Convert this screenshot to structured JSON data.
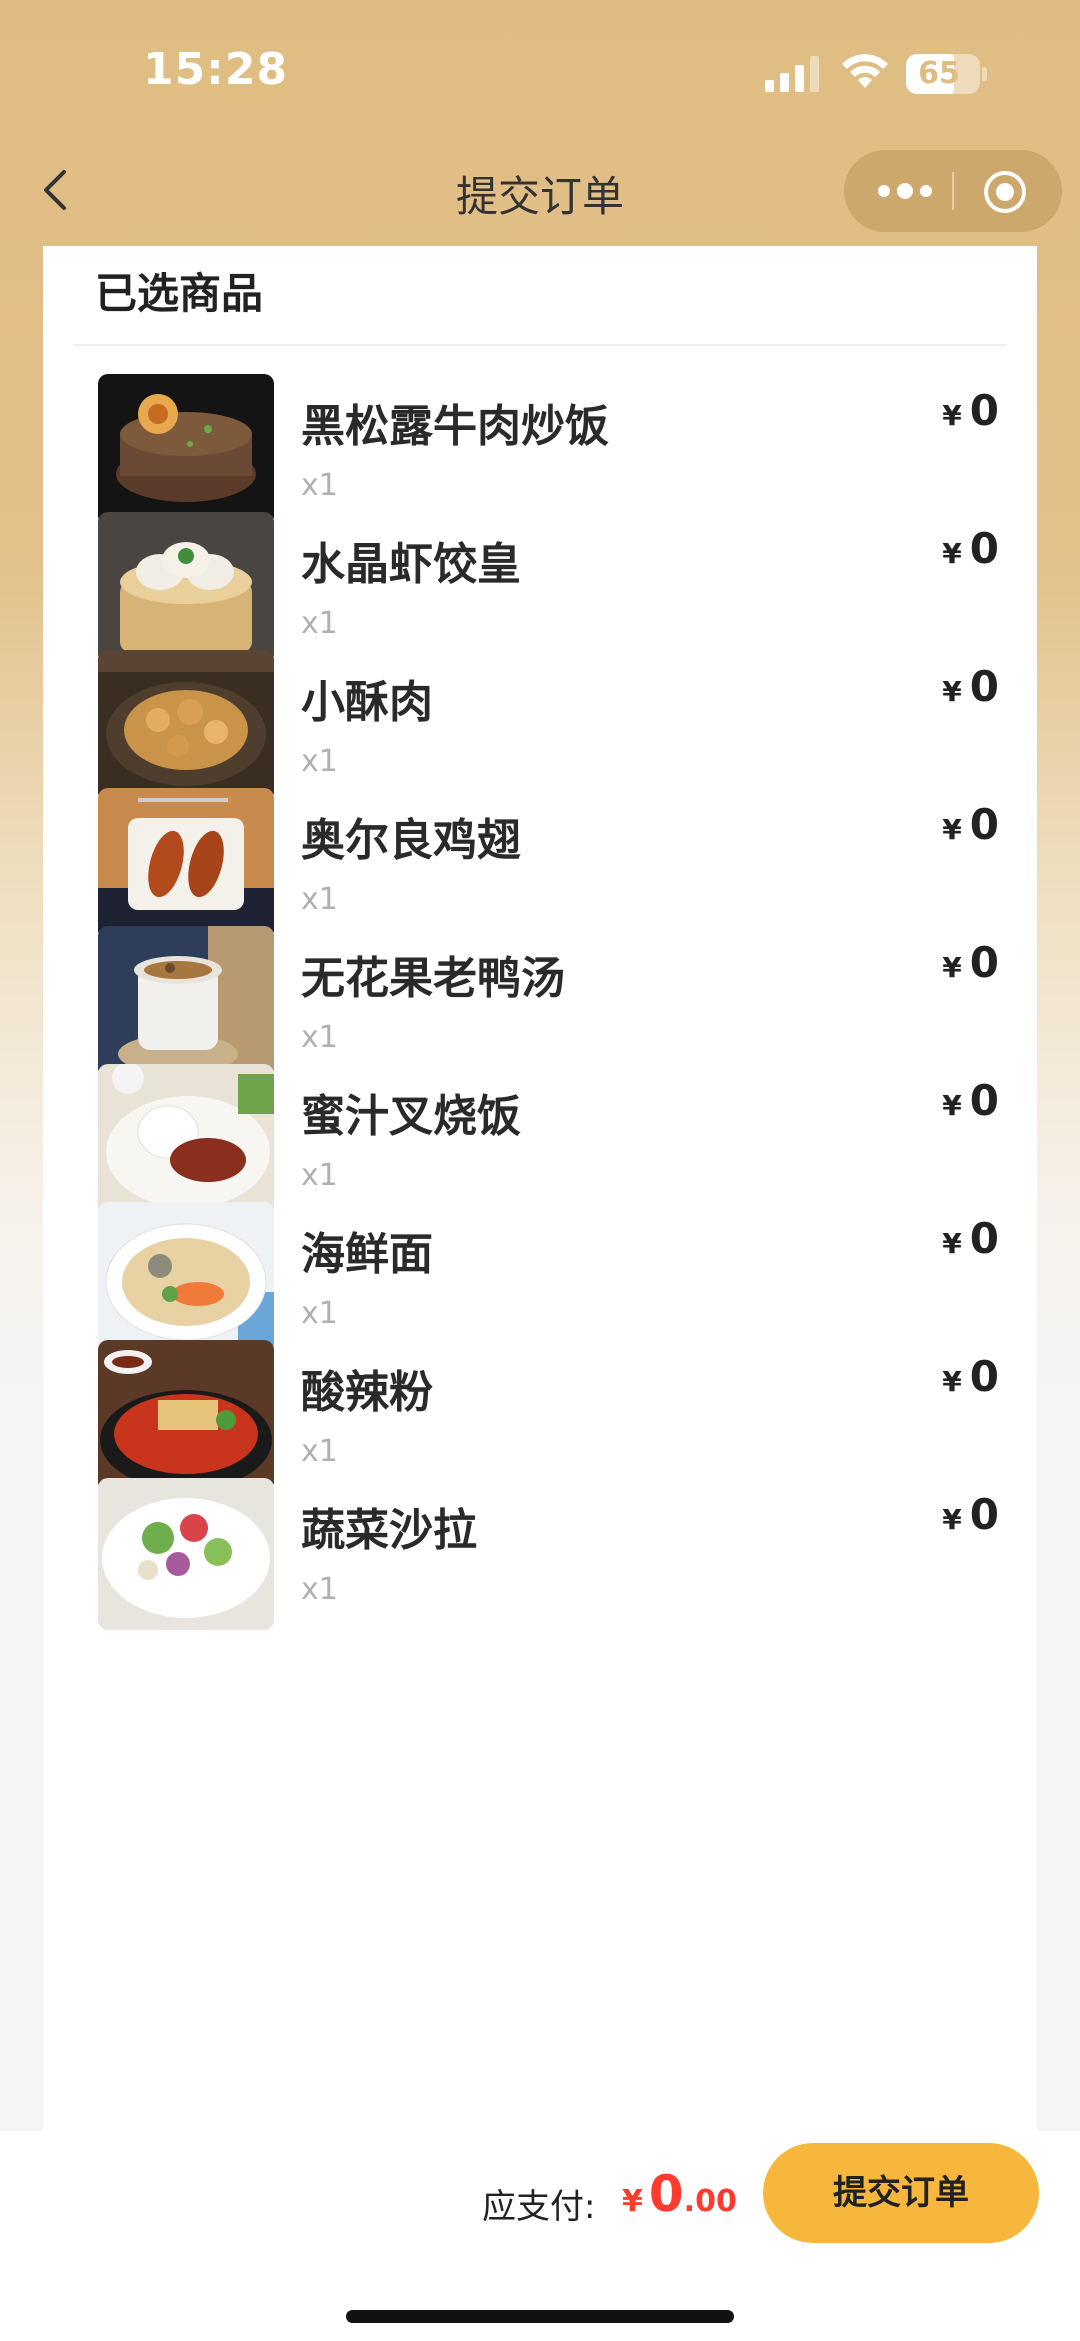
{
  "status_bar": {
    "time": "15:28",
    "battery": "65"
  },
  "nav": {
    "title": "提交订单"
  },
  "order": {
    "section_title": "已选商品",
    "currency_symbol": "¥",
    "items": [
      {
        "name": "黑松露牛肉炒饭",
        "qty": "x1",
        "price": "0"
      },
      {
        "name": "水晶虾饺皇",
        "qty": "x1",
        "price": "0"
      },
      {
        "name": "小酥肉",
        "qty": "x1",
        "price": "0"
      },
      {
        "name": "奥尔良鸡翅",
        "qty": "x1",
        "price": "0"
      },
      {
        "name": "无花果老鸭汤",
        "qty": "x1",
        "price": "0"
      },
      {
        "name": "蜜汁叉烧饭",
        "qty": "x1",
        "price": "0"
      },
      {
        "name": "海鲜面",
        "qty": "x1",
        "price": "0"
      },
      {
        "name": "酸辣粉",
        "qty": "x1",
        "price": "0"
      },
      {
        "name": "蔬菜沙拉",
        "qty": "x1",
        "price": "0"
      }
    ]
  },
  "footer": {
    "pay_label": "应支付:",
    "currency_symbol": "¥",
    "amount_int": "0",
    "amount_dec": ".00",
    "submit_label": "提交订单"
  },
  "colors": {
    "accent": "#f6b73c",
    "price_red": "#ff3b2f",
    "header_gold": "#dfbd82"
  }
}
